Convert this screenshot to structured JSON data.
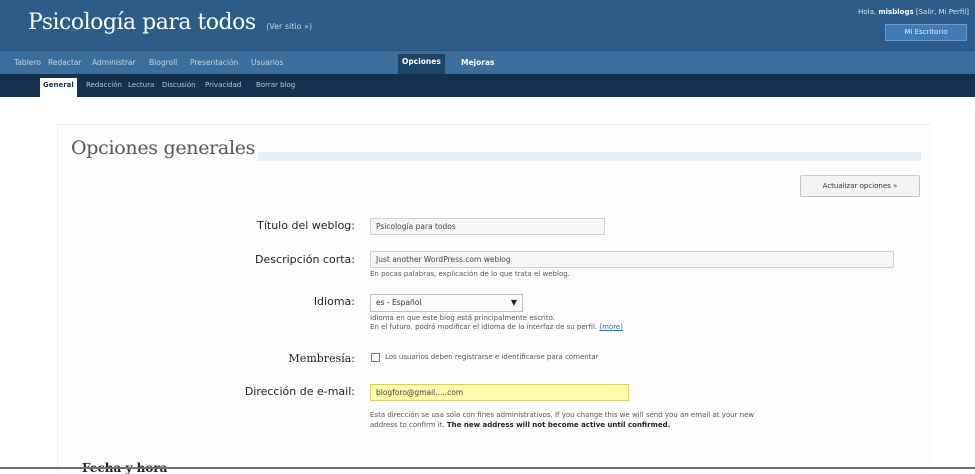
{
  "header": {
    "blog_title": "Psicología para todos",
    "view_site": "(Ver sitio »)",
    "user_greeting": "Hola,",
    "user_name": "misblogs",
    "user_links": "[Salir, Mi Perfil]",
    "dashboard_button": "Mi Escritorio"
  },
  "menu": {
    "items": [
      "Tablero",
      "Redactar",
      "Administrar",
      "Blogroll",
      "Presentación",
      "Usuarios",
      "Opciones",
      "Mejoras"
    ],
    "active": "Opciones"
  },
  "submenu": {
    "items": [
      "General",
      "Redacción",
      "Lectura",
      "Discusión",
      "Privacidad",
      "Borrar blog"
    ],
    "active": "General"
  },
  "page": {
    "title": "Opciones generales",
    "update_button": "Actualizar opciones »"
  },
  "form": {
    "weblog_title_label": "Título del weblog:",
    "weblog_title_value": "Psicología para todos",
    "tagline_label": "Descripción corta:",
    "tagline_value": "Just another WordPress.com weblog",
    "tagline_hint": "En pocas palabras, explicación de lo que trata el weblog.",
    "language_label": "Idioma:",
    "language_value": "es - Español",
    "language_hint_1": "Idioma en que este blog está principalmente escrito.",
    "language_hint_2": "En el futuro, podrá modificar el idioma de la interfaz de su perfil.",
    "language_hint_link": "(more)",
    "membership_label": "Membresía:",
    "membership_text": "Los usuarios deben registrarse e identificarse para comentar",
    "email_label": "Dirección de e-mail:",
    "email_value": "blogforo@gmail.....com",
    "email_hint_1": "Esta dirección se usa sólo con fines administrativos. If you change this we will send you an email at your new",
    "email_hint_2a": "address to confirm it.",
    "email_hint_2b": "The new address will not become active until confirmed."
  },
  "section": {
    "date_time_title": "Fecha y hora"
  },
  "colors": {
    "header_bg": "#2c5d8a",
    "menu_bg": "#3a6f9d",
    "submenu_bg": "#16314d",
    "email_highlight": "#fffaa8"
  }
}
